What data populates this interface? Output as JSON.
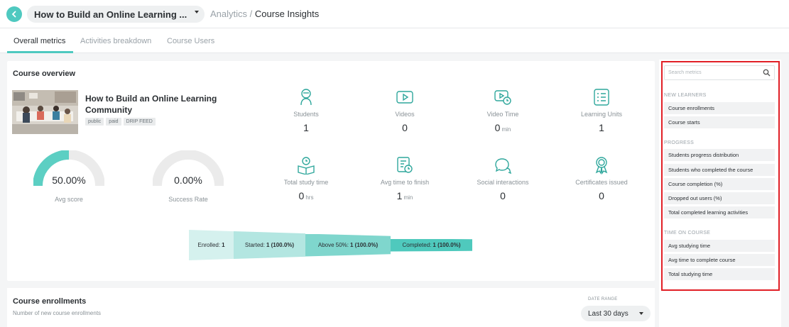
{
  "header": {
    "course_select": "How to Build an Online Learning ...",
    "crumb_section": "Analytics",
    "crumb_sep": "/",
    "crumb_current": "Course Insights"
  },
  "tabs": [
    {
      "label": "Overall metrics",
      "active": true
    },
    {
      "label": "Activities breakdown",
      "active": false
    },
    {
      "label": "Course Users",
      "active": false
    }
  ],
  "overview": {
    "title": "Course overview",
    "course_name": "How to Build an Online Learning Community",
    "tags": [
      "public",
      "paid",
      "DRIP FEED"
    ],
    "gauges": [
      {
        "value": "50.00%",
        "label": "Avg score",
        "fraction": 0.5
      },
      {
        "value": "0.00%",
        "label": "Success Rate",
        "fraction": 0.0
      }
    ],
    "metrics": [
      {
        "icon": "student-icon",
        "label": "Students",
        "value": "1",
        "unit": ""
      },
      {
        "icon": "video-icon",
        "label": "Videos",
        "value": "0",
        "unit": ""
      },
      {
        "icon": "video-time-icon",
        "label": "Video Time",
        "value": "0",
        "unit": "min"
      },
      {
        "icon": "learning-units-icon",
        "label": "Learning Units",
        "value": "1",
        "unit": ""
      },
      {
        "icon": "study-time-icon",
        "label": "Total study time",
        "value": "0",
        "unit": "hrs"
      },
      {
        "icon": "time-to-finish-icon",
        "label": "Avg time to finish",
        "value": "1",
        "unit": "min"
      },
      {
        "icon": "chat-icon",
        "label": "Social interactions",
        "value": "0",
        "unit": ""
      },
      {
        "icon": "certificate-icon",
        "label": "Certificates issued",
        "value": "0",
        "unit": ""
      }
    ],
    "funnel": [
      {
        "label": "Enrolled:",
        "value": "1",
        "color": "#d5f1ee"
      },
      {
        "label": "Started:",
        "value": "1 (100.0%)",
        "color": "#b3e6e1"
      },
      {
        "label": "Above 50%:",
        "value": "1 (100.0%)",
        "color": "#7fd6cd"
      },
      {
        "label": "Completed:",
        "value": "1 (100.0%)",
        "color": "#4fc9bd"
      }
    ]
  },
  "enrollments": {
    "title": "Course enrollments",
    "subtitle": "Number of new course enrollments",
    "date_range_label": "DATE RANGE",
    "date_range_value": "Last 30 days"
  },
  "sidebar": {
    "search_placeholder": "Search metrics",
    "sections": [
      {
        "title": "NEW LEARNERS",
        "items": [
          "Course enrollments",
          "Course starts"
        ]
      },
      {
        "title": "PROGRESS",
        "items": [
          "Students progress distribution",
          "Students who completed the course",
          "Course completion (%)",
          "Dropped out users (%)",
          "Total completed learning activities"
        ]
      },
      {
        "title": "TIME ON COURSE",
        "items": [
          "Avg studying time",
          "Avg time to complete course",
          "Total studying time"
        ]
      }
    ]
  },
  "colors": {
    "accent": "#4fc9c0",
    "highlight_border": "#e11f26"
  }
}
